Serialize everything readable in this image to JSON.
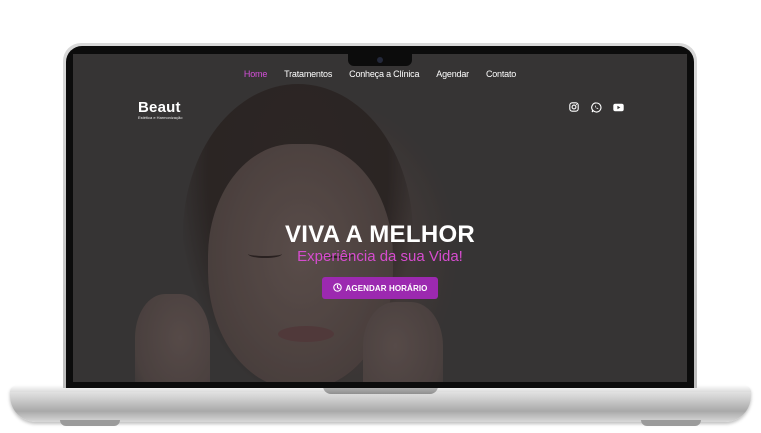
{
  "nav": {
    "items": [
      {
        "label": "Home",
        "active": true
      },
      {
        "label": "Tratamentos",
        "active": false
      },
      {
        "label": "Conheça a Clínica",
        "active": false
      },
      {
        "label": "Agendar",
        "active": false
      },
      {
        "label": "Contato",
        "active": false
      }
    ]
  },
  "logo": {
    "title": "Beaut",
    "subtitle": "Estética e Harmonização"
  },
  "social": {
    "icons": [
      "instagram-icon",
      "whatsapp-icon",
      "youtube-icon"
    ]
  },
  "hero": {
    "title": "VIVA A MELHOR",
    "subtitle": "Experiência da sua Vida!",
    "cta_label": "AGENDAR HORÁRIO",
    "cta_icon": "clock-icon"
  },
  "colors": {
    "accent": "#d34fd8",
    "button": "#9c29b0",
    "subtitle": "#d64ccf"
  }
}
